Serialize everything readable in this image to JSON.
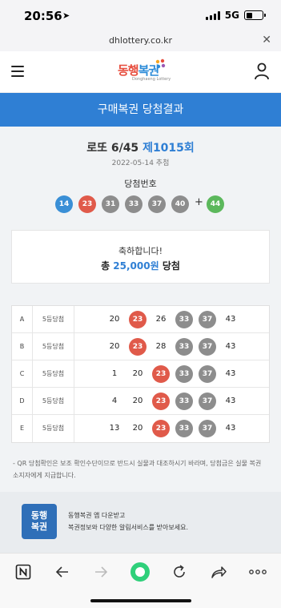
{
  "status": {
    "time": "20:56",
    "network": "5G"
  },
  "browser": {
    "url": "dhlottery.co.kr"
  },
  "header": {
    "logo_part1": "동행",
    "logo_part2": "복권",
    "logo_sub": "Donghaeng Lottery"
  },
  "page_title": "구매복권 당첨결과",
  "draw": {
    "game": "로또 6/45",
    "round": "제1015회",
    "date": "2022-05-14 추첨",
    "winning_label": "당첨번호",
    "numbers": [
      "14",
      "23",
      "31",
      "33",
      "37",
      "40"
    ],
    "bonus": "44",
    "plus_sign": "+",
    "ball_colors": [
      "#3a8fd6",
      "#e05a4a",
      "#8d8d8d",
      "#8d8d8d",
      "#8d8d8d",
      "#8d8d8d"
    ],
    "bonus_color": "#5cb85c"
  },
  "prize": {
    "congrats": "축하합니다!",
    "prefix": "총",
    "amount": "25,000원",
    "suffix": "당첨"
  },
  "tickets": [
    {
      "letter": "A",
      "rank": "5등당첨",
      "numbers": [
        "20",
        "23",
        "26",
        "33",
        "37",
        "43"
      ],
      "hits": [
        "",
        "red",
        "",
        "gray",
        "gray",
        ""
      ]
    },
    {
      "letter": "B",
      "rank": "5등당첨",
      "numbers": [
        "20",
        "23",
        "28",
        "33",
        "37",
        "43"
      ],
      "hits": [
        "",
        "red",
        "",
        "gray",
        "gray",
        ""
      ]
    },
    {
      "letter": "C",
      "rank": "5등당첨",
      "numbers": [
        "1",
        "20",
        "23",
        "33",
        "37",
        "43"
      ],
      "hits": [
        "",
        "",
        "red",
        "gray",
        "gray",
        ""
      ]
    },
    {
      "letter": "D",
      "rank": "5등당첨",
      "numbers": [
        "4",
        "20",
        "23",
        "33",
        "37",
        "43"
      ],
      "hits": [
        "",
        "",
        "red",
        "gray",
        "gray",
        ""
      ]
    },
    {
      "letter": "E",
      "rank": "5등당첨",
      "numbers": [
        "13",
        "20",
        "23",
        "33",
        "37",
        "43"
      ],
      "hits": [
        "",
        "",
        "red",
        "gray",
        "gray",
        ""
      ]
    }
  ],
  "notice_line1": "- QR 당첨확인은 보조 확인수단이므로 반드시 실물과 대조하시기 바라며, 당첨금은 실물 복권",
  "notice_line2": "소지자에게 지급합니다.",
  "banner": {
    "logo_line1": "동행",
    "logo_line2": "복권",
    "line1": "동행복권 앱 다운받고",
    "line2": "복권정보와 다양한 알림서비스를 받아보세요."
  }
}
